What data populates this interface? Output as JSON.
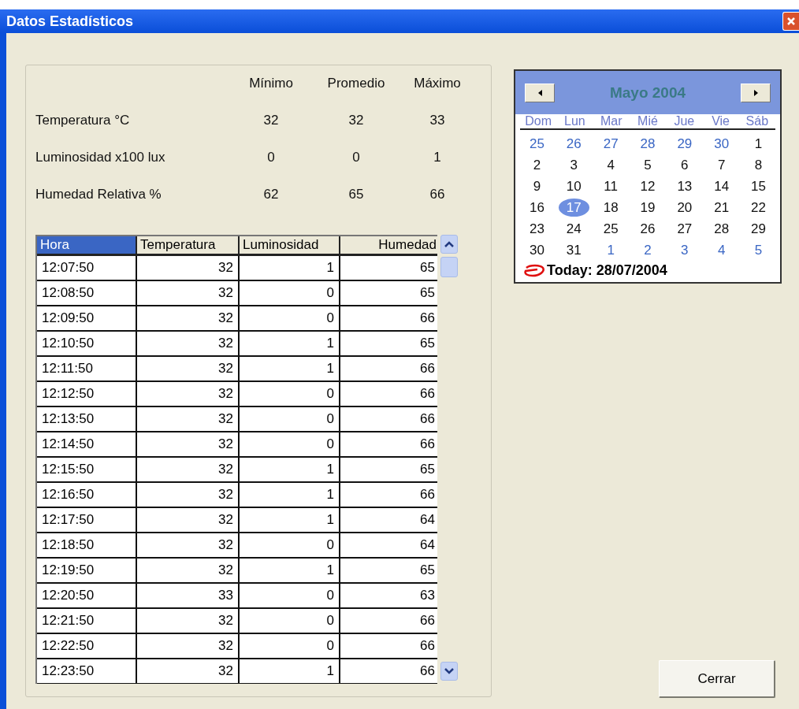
{
  "window": {
    "title": "Datos Estadísticos"
  },
  "summary": {
    "columns": [
      "Mínimo",
      "Promedio",
      "Máximo"
    ],
    "rows": [
      {
        "label": "Temperatura °C",
        "values": [
          "32",
          "32",
          "33"
        ]
      },
      {
        "label": "Luminosidad x100 lux",
        "values": [
          "0",
          "0",
          "1"
        ]
      },
      {
        "label": "Humedad Relativa %",
        "values": [
          "62",
          "65",
          "66"
        ]
      }
    ]
  },
  "table": {
    "columns": [
      {
        "label": "Hora",
        "selected": true
      },
      {
        "label": "Temperatura",
        "selected": false
      },
      {
        "label": "Luminosidad",
        "selected": false
      },
      {
        "label": "Humedad",
        "selected": false
      }
    ],
    "rows": [
      [
        "12:07:50",
        "32",
        "1",
        "65"
      ],
      [
        "12:08:50",
        "32",
        "0",
        "65"
      ],
      [
        "12:09:50",
        "32",
        "0",
        "66"
      ],
      [
        "12:10:50",
        "32",
        "1",
        "65"
      ],
      [
        "12:11:50",
        "32",
        "1",
        "66"
      ],
      [
        "12:12:50",
        "32",
        "0",
        "66"
      ],
      [
        "12:13:50",
        "32",
        "0",
        "66"
      ],
      [
        "12:14:50",
        "32",
        "0",
        "66"
      ],
      [
        "12:15:50",
        "32",
        "1",
        "65"
      ],
      [
        "12:16:50",
        "32",
        "1",
        "66"
      ],
      [
        "12:17:50",
        "32",
        "1",
        "64"
      ],
      [
        "12:18:50",
        "32",
        "0",
        "64"
      ],
      [
        "12:19:50",
        "32",
        "1",
        "65"
      ],
      [
        "12:20:50",
        "33",
        "0",
        "63"
      ],
      [
        "12:21:50",
        "32",
        "0",
        "66"
      ],
      [
        "12:22:50",
        "32",
        "0",
        "66"
      ],
      [
        "12:23:50",
        "32",
        "1",
        "66"
      ]
    ]
  },
  "calendar": {
    "month": "Mayo 2004",
    "weekdays": [
      "Dom",
      "Lun",
      "Mar",
      "Mié",
      "Jue",
      "Vie",
      "Sáb"
    ],
    "weeks": [
      [
        {
          "day": "25",
          "other_month": true,
          "selected": false
        },
        {
          "day": "26",
          "other_month": true,
          "selected": false
        },
        {
          "day": "27",
          "other_month": true,
          "selected": false
        },
        {
          "day": "28",
          "other_month": true,
          "selected": false
        },
        {
          "day": "29",
          "other_month": true,
          "selected": false
        },
        {
          "day": "30",
          "other_month": true,
          "selected": false
        },
        {
          "day": "1",
          "other_month": false,
          "selected": false
        }
      ],
      [
        {
          "day": "2",
          "other_month": false,
          "selected": false
        },
        {
          "day": "3",
          "other_month": false,
          "selected": false
        },
        {
          "day": "4",
          "other_month": false,
          "selected": false
        },
        {
          "day": "5",
          "other_month": false,
          "selected": false
        },
        {
          "day": "6",
          "other_month": false,
          "selected": false
        },
        {
          "day": "7",
          "other_month": false,
          "selected": false
        },
        {
          "day": "8",
          "other_month": false,
          "selected": false
        }
      ],
      [
        {
          "day": "9",
          "other_month": false,
          "selected": false
        },
        {
          "day": "10",
          "other_month": false,
          "selected": false
        },
        {
          "day": "11",
          "other_month": false,
          "selected": false
        },
        {
          "day": "12",
          "other_month": false,
          "selected": false
        },
        {
          "day": "13",
          "other_month": false,
          "selected": false
        },
        {
          "day": "14",
          "other_month": false,
          "selected": false
        },
        {
          "day": "15",
          "other_month": false,
          "selected": false
        }
      ],
      [
        {
          "day": "16",
          "other_month": false,
          "selected": false
        },
        {
          "day": "17",
          "other_month": false,
          "selected": true
        },
        {
          "day": "18",
          "other_month": false,
          "selected": false
        },
        {
          "day": "19",
          "other_month": false,
          "selected": false
        },
        {
          "day": "20",
          "other_month": false,
          "selected": false
        },
        {
          "day": "21",
          "other_month": false,
          "selected": false
        },
        {
          "day": "22",
          "other_month": false,
          "selected": false
        }
      ],
      [
        {
          "day": "23",
          "other_month": false,
          "selected": false
        },
        {
          "day": "24",
          "other_month": false,
          "selected": false
        },
        {
          "day": "25",
          "other_month": false,
          "selected": false
        },
        {
          "day": "26",
          "other_month": false,
          "selected": false
        },
        {
          "day": "27",
          "other_month": false,
          "selected": false
        },
        {
          "day": "28",
          "other_month": false,
          "selected": false
        },
        {
          "day": "29",
          "other_month": false,
          "selected": false
        }
      ],
      [
        {
          "day": "30",
          "other_month": false,
          "selected": false
        },
        {
          "day": "31",
          "other_month": false,
          "selected": false
        },
        {
          "day": "1",
          "other_month": true,
          "selected": false
        },
        {
          "day": "2",
          "other_month": true,
          "selected": false
        },
        {
          "day": "3",
          "other_month": true,
          "selected": false
        },
        {
          "day": "4",
          "other_month": true,
          "selected": false
        },
        {
          "day": "5",
          "other_month": true,
          "selected": false
        }
      ]
    ],
    "today": "Today: 28/07/2004"
  },
  "buttons": [
    "Cerrar"
  ]
}
